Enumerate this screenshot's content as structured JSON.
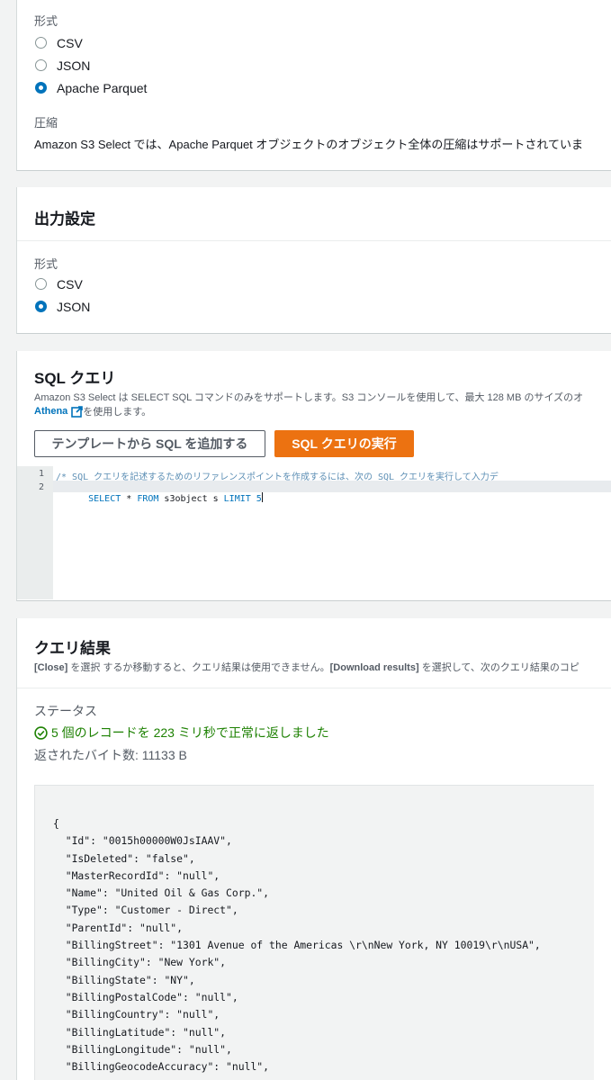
{
  "input_panel": {
    "format_label": "形式",
    "formats": [
      {
        "label": "CSV",
        "selected": false
      },
      {
        "label": "JSON",
        "selected": false
      },
      {
        "label": "Apache Parquet",
        "selected": true
      }
    ],
    "compression_label": "圧縮",
    "compression_text": "Amazon S3 Select では、Apache Parquet オブジェクトのオブジェクト全体の圧縮はサポートされていま"
  },
  "output_panel": {
    "title": "出力設定",
    "format_label": "形式",
    "formats": [
      {
        "label": "CSV",
        "selected": false
      },
      {
        "label": "JSON",
        "selected": true
      }
    ]
  },
  "sql_panel": {
    "title": "SQL クエリ",
    "desc_line1": "Amazon S3 Select は SELECT SQL コマンドのみをサポートします。S3 コンソールを使用して、最大 128 MB のサイズのオ",
    "athena_link": "Athena",
    "desc_line2_suffix": "を使用します。",
    "add_template_button": "テンプレートから SQL を追加する",
    "run_button": "SQL クエリの実行",
    "editor": {
      "line_numbers": [
        "1",
        "2"
      ],
      "line1": "/* SQL クエリを記述するためのリファレンスポイントを作成するには、次の SQL クエリを実行して入力デ",
      "line2_kw1": "SELECT",
      "line2_mid": " * ",
      "line2_kw2": "FROM",
      "line2_obj": " s3object s ",
      "line2_kw3": "LIMIT",
      "line2_num": " 5"
    }
  },
  "results_panel": {
    "title": "クエリ結果",
    "desc_close": "[Close]",
    "desc_mid": " を選択 するか移動すると、クエリ結果は使用できません。",
    "desc_download": "[Download results]",
    "desc_end": " を選択して、次のクエリ結果のコピ",
    "status_label": "ステータス",
    "status_text": "5 個のレコードを 223 ミリ秒で正常に返しました",
    "bytes_text": "返されたバイト数: 11133 B",
    "status_color": "#1d8102",
    "json_lines": [
      "{",
      "  \"Id\": \"0015h00000W0JsIAAV\",",
      "  \"IsDeleted\": \"false\",",
      "  \"MasterRecordId\": \"null\",",
      "  \"Name\": \"United Oil & Gas Corp.\",",
      "  \"Type\": \"Customer - Direct\",",
      "  \"ParentId\": \"null\",",
      "  \"BillingStreet\": \"1301 Avenue of the Americas \\r\\nNew York, NY 10019\\r\\nUSA\",",
      "  \"BillingCity\": \"New York\",",
      "  \"BillingState\": \"NY\",",
      "  \"BillingPostalCode\": \"null\",",
      "  \"BillingCountry\": \"null\",",
      "  \"BillingLatitude\": \"null\",",
      "  \"BillingLongitude\": \"null\",",
      "  \"BillingGeocodeAccuracy\": \"null\","
    ]
  },
  "icons": {
    "external_link": "external-link-icon",
    "success": "check-circle-icon"
  },
  "colors": {
    "accent": "#0073bb",
    "primary_button": "#ec7211",
    "success": "#1d8102"
  }
}
